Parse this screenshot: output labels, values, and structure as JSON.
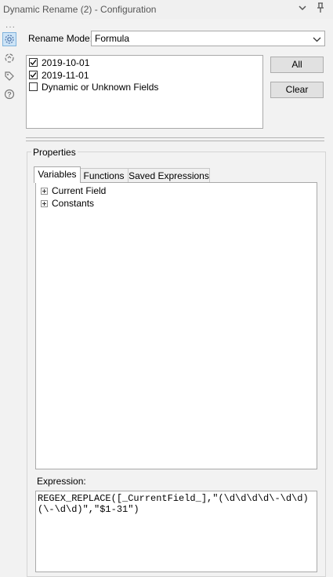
{
  "window": {
    "title": "Dynamic Rename (2) - Configuration",
    "icons": [
      "chevron-down-icon",
      "pin-icon"
    ]
  },
  "sidebar": {
    "icons": [
      "gear-icon",
      "refresh-icon",
      "tag-icon",
      "help-icon"
    ],
    "active": "gear-icon"
  },
  "rename_mode": {
    "label": "Rename Mode:",
    "value": "Formula"
  },
  "fields": [
    {
      "label": "2019-10-01",
      "checked": true
    },
    {
      "label": "2019-11-01",
      "checked": true
    },
    {
      "label": "Dynamic or Unknown Fields",
      "checked": false
    }
  ],
  "buttons": {
    "all": "All",
    "clear": "Clear"
  },
  "properties": {
    "legend": "Properties",
    "tabs": [
      "Variables",
      "Functions",
      "Saved Expressions"
    ],
    "active_tab": "Variables",
    "tree": [
      "Current Field",
      "Constants"
    ],
    "expression_label": "Expression:",
    "expression": "REGEX_REPLACE([_CurrentField_],\"(\\d\\d\\d\\d\\-\\d\\d)(\\-\\d\\d)\",\"$1-31\")"
  }
}
